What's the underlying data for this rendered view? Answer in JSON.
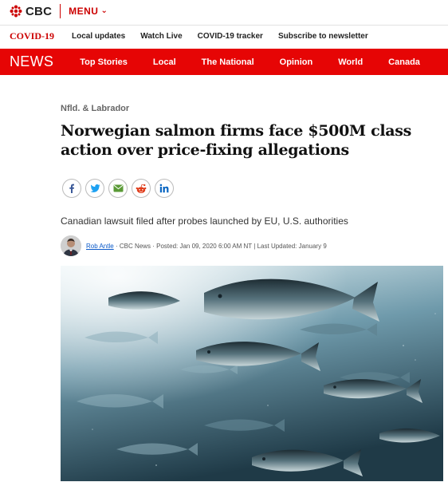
{
  "header": {
    "brand": "CBC",
    "menu_label": "MENU"
  },
  "covid_bar": {
    "label": "COVID-19",
    "links": [
      "Local updates",
      "Watch Live",
      "COVID-19 tracker",
      "Subscribe to newsletter"
    ]
  },
  "news_bar": {
    "label": "NEWS",
    "items": [
      "Top Stories",
      "Local",
      "The National",
      "Opinion",
      "World",
      "Canada"
    ]
  },
  "article": {
    "section": "Nfld. & Labrador",
    "headline": "Norwegian salmon firms face $500M class action over price-fixing allegations",
    "deck": "Canadian lawsuit filed after probes launched by EU, U.S. authorities",
    "byline": {
      "author": "Rob Antle",
      "outlet": "CBC News",
      "posted": "Posted: Jan 09, 2020 6:00 AM NT",
      "updated": "Last Updated: January 9",
      "separator": "·",
      "pipe": "|"
    },
    "share": [
      "facebook-icon",
      "twitter-icon",
      "email-icon",
      "reddit-icon",
      "linkedin-icon"
    ]
  },
  "colors": {
    "brand_red": "#e60505",
    "link_blue": "#0b5ac9"
  }
}
